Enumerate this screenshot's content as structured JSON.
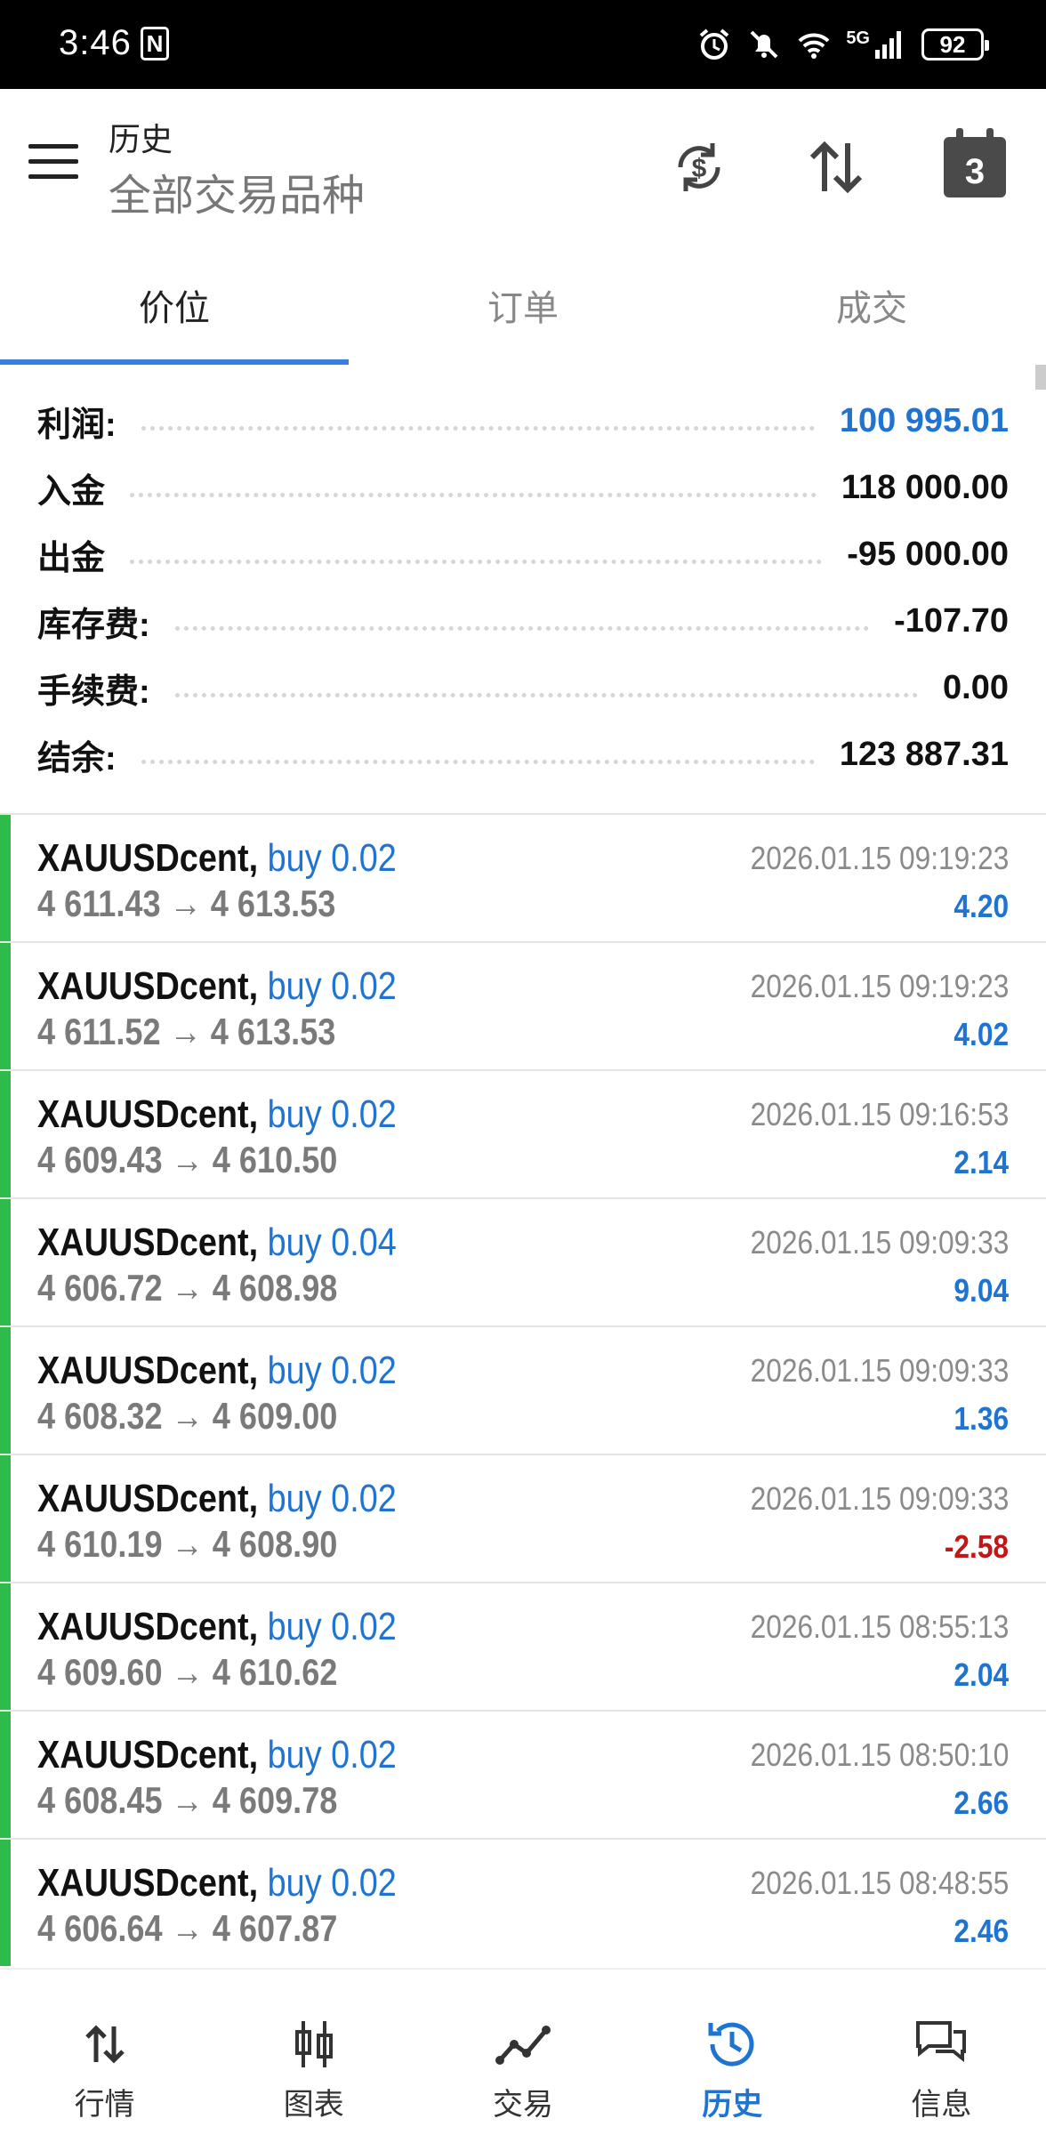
{
  "status_bar": {
    "time": "3:46",
    "nfc": "N",
    "network": "5G",
    "battery": "92"
  },
  "header": {
    "title": "历史",
    "subtitle": "全部交易品种",
    "calendar_day": "3"
  },
  "tabs": [
    {
      "label": "价位",
      "active": true
    },
    {
      "label": "订单",
      "active": false
    },
    {
      "label": "成交",
      "active": false
    }
  ],
  "summary": [
    {
      "label": "利润:",
      "value": "100 995.01"
    },
    {
      "label": "入金",
      "value": "118 000.00"
    },
    {
      "label": "出金",
      "value": "-95 000.00"
    },
    {
      "label": "库存费:",
      "value": "-107.70"
    },
    {
      "label": "手续费:",
      "value": "0.00"
    },
    {
      "label": "结余:",
      "value": "123 887.31"
    }
  ],
  "deals": [
    {
      "symbol": "XAUUSDcent,",
      "direction": "buy 0.02",
      "prices": "4 611.43 → 4 613.53",
      "time": "2026.01.15 09:19:23",
      "profit": "4.20"
    },
    {
      "symbol": "XAUUSDcent,",
      "direction": "buy 0.02",
      "prices": "4 611.52 → 4 613.53",
      "time": "2026.01.15 09:19:23",
      "profit": "4.02"
    },
    {
      "symbol": "XAUUSDcent,",
      "direction": "buy 0.02",
      "prices": "4 609.43 → 4 610.50",
      "time": "2026.01.15 09:16:53",
      "profit": "2.14"
    },
    {
      "symbol": "XAUUSDcent,",
      "direction": "buy 0.04",
      "prices": "4 606.72 → 4 608.98",
      "time": "2026.01.15 09:09:33",
      "profit": "9.04"
    },
    {
      "symbol": "XAUUSDcent,",
      "direction": "buy 0.02",
      "prices": "4 608.32 → 4 609.00",
      "time": "2026.01.15 09:09:33",
      "profit": "1.36"
    },
    {
      "symbol": "XAUUSDcent,",
      "direction": "buy 0.02",
      "prices": "4 610.19 → 4 608.90",
      "time": "2026.01.15 09:09:33",
      "profit": "-2.58"
    },
    {
      "symbol": "XAUUSDcent,",
      "direction": "buy 0.02",
      "prices": "4 609.60 → 4 610.62",
      "time": "2026.01.15 08:55:13",
      "profit": "2.04"
    },
    {
      "symbol": "XAUUSDcent,",
      "direction": "buy 0.02",
      "prices": "4 608.45 → 4 609.78",
      "time": "2026.01.15 08:50:10",
      "profit": "2.66"
    },
    {
      "symbol": "XAUUSDcent,",
      "direction": "buy 0.02",
      "prices": "4 606.64 → 4 607.87",
      "time": "2026.01.15 08:48:55",
      "profit": "2.46"
    }
  ],
  "bottom_nav": [
    {
      "label": "行情",
      "icon": "arrows-updown-icon",
      "active": false
    },
    {
      "label": "图表",
      "icon": "candlestick-icon",
      "active": false
    },
    {
      "label": "交易",
      "icon": "trade-line-icon",
      "active": false
    },
    {
      "label": "历史",
      "icon": "history-clock-icon",
      "active": true
    },
    {
      "label": "信息",
      "icon": "chat-bubbles-icon",
      "active": false
    }
  ],
  "colors": {
    "accent": "#1f74d2",
    "negative": "#c01818",
    "buy_bar": "#2dbb4a",
    "tab_indicator": "#3b7ddd"
  }
}
